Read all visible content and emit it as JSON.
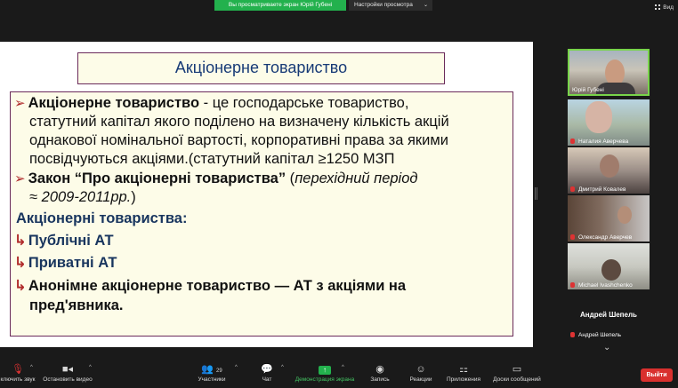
{
  "top_bar": {
    "share_banner": "Вы просматриваете экран Юрій Губені",
    "view_options_label": "Настройки просмотра",
    "view_button": "Вид"
  },
  "slide": {
    "title": "Акціонерне товариство",
    "bullet1": {
      "term": "Акціонерне товариство",
      "line1_rest": " - це господарське товариство,",
      "line2": "статутний капітал якого поділено на визначену кількість акцій",
      "line3": "однакової номінальної вартості, корпоративні права за якими",
      "line4": "посвідчуються акціями.(статутний капітал ≥1250 МЗП"
    },
    "bullet2": {
      "law": "Закон “Про акціонерні товариства”",
      "paren_open": " (",
      "italic1": "перехідний період",
      "italic2": "≈ 2009-2011рр.",
      "paren_close": ")"
    },
    "heading": "Акціонерні товариства:",
    "item1": "Публічні АТ",
    "item2": "Приватні АТ",
    "item3_line1": "Анонімне акціонерне товариство — АТ з акціями на",
    "item3_line2": "пред'явника."
  },
  "participants": [
    {
      "name": "Юрій Губені"
    },
    {
      "name": "Наталия Аверчева"
    },
    {
      "name": "Дмитрий Ковалев"
    },
    {
      "name": "Олександр Аверчев"
    },
    {
      "name": "Michael Ivashchenko"
    },
    {
      "name": "Андрей Шепель",
      "display_name": "Андрей Шепель"
    }
  ],
  "toolbar": {
    "mute": "ключить звук",
    "video": "Остановить видео",
    "participants": "Участники",
    "participants_count": "29",
    "chat": "Чат",
    "share": "Демонстрация экрана",
    "record": "Запись",
    "reactions": "Реакции",
    "apps": "Приложения",
    "whiteboards": "Доски сообщений",
    "exit": "Выйти"
  },
  "colors": {
    "share_green": "#23b14d",
    "active_speaker": "#78d44a",
    "exit_red": "#d9302e",
    "slide_navy": "#18355e",
    "slide_bullet_red": "#b02b2b"
  }
}
